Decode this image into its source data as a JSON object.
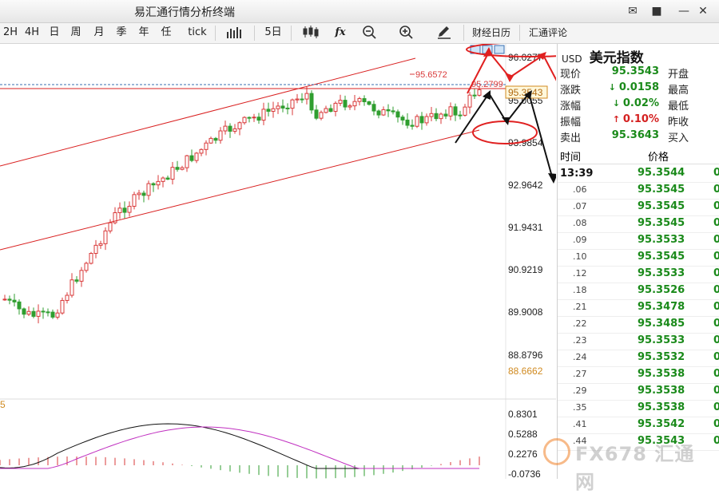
{
  "window": {
    "title": "易汇通行情分析终端",
    "icons": [
      "mail-icon",
      "shirt-icon",
      "minimize-icon",
      "close-icon"
    ]
  },
  "toolbar": {
    "timeframes": [
      "2H",
      "4H",
      "日",
      "周",
      "月",
      "季",
      "年",
      "任",
      "tick"
    ],
    "period_label": "5日",
    "buttons": [
      "财经日历",
      "汇通评论"
    ]
  },
  "chart": {
    "price_axis": [
      "96.0277",
      "95.0055",
      "93.9854",
      "92.9642",
      "91.9431",
      "90.9219",
      "89.9008",
      "88.8796",
      "88.6662"
    ],
    "current_price_tag": "95.3543",
    "high_label": "95.6572",
    "annotation_price": "95.2799",
    "macd_axis": [
      "0.8301",
      "0.5288",
      "0.2276",
      "-0.0736"
    ],
    "macd_label": "5",
    "colors": {
      "up": "#d93a3a",
      "down": "#2f9e2f",
      "trendline": "#d92020",
      "annotation": "#e02020",
      "projection": "#111111"
    }
  },
  "quote": {
    "symbol": "USD",
    "name": "美元指数",
    "rows": [
      {
        "label": "现价",
        "value": "95.3543",
        "color": "#1a8a1a",
        "arrow": "",
        "label2": "开盘"
      },
      {
        "label": "涨跌",
        "value": "0.0158",
        "color": "#1a8a1a",
        "arrow": "down",
        "label2": "最高"
      },
      {
        "label": "涨幅",
        "value": "0.02%",
        "color": "#1a8a1a",
        "arrow": "down",
        "label2": "最低"
      },
      {
        "label": "振幅",
        "value": "0.10%",
        "color": "#d42020",
        "arrow": "up",
        "label2": "昨收"
      },
      {
        "label": "卖出",
        "value": "95.3643",
        "color": "#1a8a1a",
        "arrow": "",
        "label2": "买入"
      }
    ]
  },
  "ticks": {
    "header_time": "时间",
    "header_price": "价格",
    "rows": [
      {
        "time": "13:39",
        "price": "95.3544",
        "vol": "0"
      },
      {
        "time": ".06",
        "price": "95.3545",
        "vol": "0"
      },
      {
        "time": ".07",
        "price": "95.3545",
        "vol": "0"
      },
      {
        "time": ".08",
        "price": "95.3545",
        "vol": "0"
      },
      {
        "time": ".09",
        "price": "95.3533",
        "vol": "0"
      },
      {
        "time": ".10",
        "price": "95.3545",
        "vol": "0"
      },
      {
        "time": ".12",
        "price": "95.3533",
        "vol": "0"
      },
      {
        "time": ".18",
        "price": "95.3526",
        "vol": "0"
      },
      {
        "time": ".21",
        "price": "95.3478",
        "vol": "0"
      },
      {
        "time": ".22",
        "price": "95.3485",
        "vol": "0"
      },
      {
        "time": ".23",
        "price": "95.3533",
        "vol": "0"
      },
      {
        "time": ".24",
        "price": "95.3532",
        "vol": "0"
      },
      {
        "time": ".27",
        "price": "95.3538",
        "vol": "0"
      },
      {
        "time": ".29",
        "price": "95.3538",
        "vol": "0"
      },
      {
        "time": ".35",
        "price": "95.3538",
        "vol": "0"
      },
      {
        "time": ".41",
        "price": "95.3542",
        "vol": "0"
      },
      {
        "time": ".44",
        "price": "95.3543",
        "vol": "0"
      }
    ]
  },
  "watermark": {
    "text": "FX678 汇通网"
  }
}
